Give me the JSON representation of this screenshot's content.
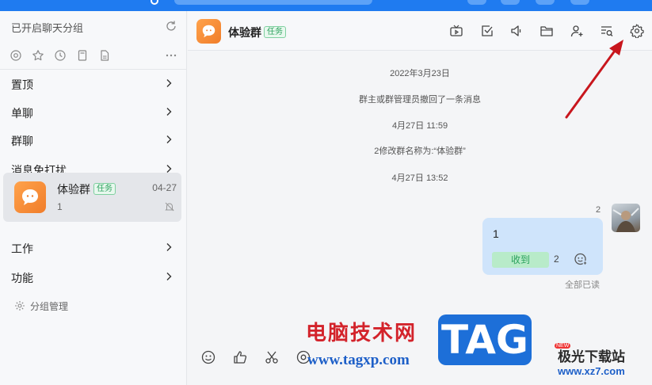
{
  "sidebar": {
    "header": "已开启聊天分组",
    "groups": [
      {
        "label": "置顶"
      },
      {
        "label": "单聊"
      },
      {
        "label": "群聊"
      },
      {
        "label": "消息免打扰"
      },
      {
        "label": "工作"
      },
      {
        "label": "功能"
      }
    ],
    "conversation": {
      "name": "体验群",
      "tag": "任务",
      "date": "04-27",
      "preview": "1"
    },
    "manage_label": "分组管理"
  },
  "chat": {
    "title": "体验群",
    "tag": "任务",
    "system_messages": [
      "2022年3月23日",
      "群主或群管理员撤回了一条消息",
      "4月27日 11:59",
      "2修改群名称为:“体验群”",
      "4月27日 13:52"
    ],
    "message": {
      "sender_count": "2",
      "text": "1",
      "receive_label": "收到",
      "receive_count": "2",
      "read_status": "全部已读"
    }
  },
  "watermark": {
    "line1": "电脑技术网",
    "url": "www.tagxp.com",
    "tag": "TAG",
    "site": "极光下载站",
    "site_url": "www.xz7.com",
    "new": "NEW"
  },
  "colors": {
    "accent": "#1f7bf0",
    "task_tag": "#2aa15c",
    "bubble": "#cfe4fb",
    "annotation_arrow": "#c8161d"
  }
}
